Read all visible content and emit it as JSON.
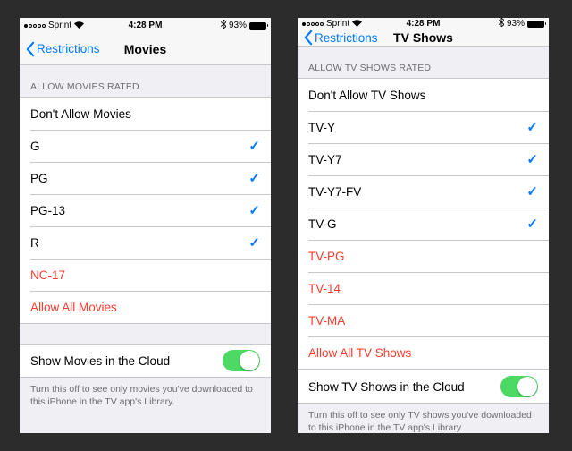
{
  "status": {
    "carrier": "Sprint",
    "time": "4:28 PM",
    "battery_pct": "93%"
  },
  "back_label": "Restrictions",
  "screens": [
    {
      "title": "Movies",
      "section_header": "ALLOW MOVIES RATED",
      "rows": [
        {
          "label": "Don't Allow Movies",
          "checked": false,
          "red": false
        },
        {
          "label": "G",
          "checked": true,
          "red": false
        },
        {
          "label": "PG",
          "checked": true,
          "red": false
        },
        {
          "label": "PG-13",
          "checked": true,
          "red": false
        },
        {
          "label": "R",
          "checked": true,
          "red": false
        },
        {
          "label": "NC-17",
          "checked": false,
          "red": true
        },
        {
          "label": "Allow All Movies",
          "checked": false,
          "red": true
        }
      ],
      "cloud_label": "Show Movies in the Cloud",
      "cloud_on": true,
      "footer": "Turn this off to see only movies you've downloaded to this iPhone in the TV app's Library."
    },
    {
      "title": "TV Shows",
      "section_header": "ALLOW TV SHOWS RATED",
      "rows": [
        {
          "label": "Don't Allow TV Shows",
          "checked": false,
          "red": false
        },
        {
          "label": "TV-Y",
          "checked": true,
          "red": false
        },
        {
          "label": "TV-Y7",
          "checked": true,
          "red": false
        },
        {
          "label": "TV-Y7-FV",
          "checked": true,
          "red": false
        },
        {
          "label": "TV-G",
          "checked": true,
          "red": false
        },
        {
          "label": "TV-PG",
          "checked": false,
          "red": true
        },
        {
          "label": "TV-14",
          "checked": false,
          "red": true
        },
        {
          "label": "TV-MA",
          "checked": false,
          "red": true
        },
        {
          "label": "Allow All TV Shows",
          "checked": false,
          "red": true
        }
      ],
      "cloud_label": "Show TV Shows in the Cloud",
      "cloud_on": true,
      "footer": "Turn this off to see only TV shows you've downloaded to this iPhone in the TV app's Library."
    }
  ]
}
